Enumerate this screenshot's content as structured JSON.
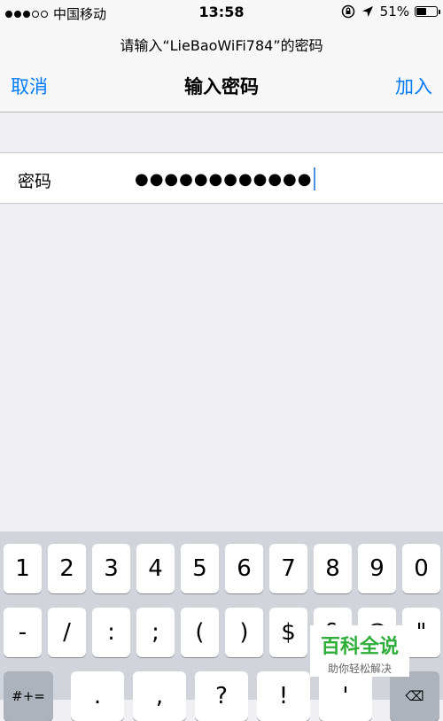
{
  "status": {
    "carrier": "中国移动",
    "time": "13:58",
    "battery": "51%",
    "battery_level": 0.51
  },
  "nav": {
    "prompt": "请输入“LieBaoWiFi784”的密码",
    "title": "输入密码",
    "cancel": "取消",
    "join": "加入"
  },
  "form": {
    "password_label": "密码",
    "password_value": "●●●●●●●●●●●●"
  },
  "keyboard": {
    "row1": [
      "1",
      "2",
      "3",
      "4",
      "5",
      "6",
      "7",
      "8",
      "9",
      "0"
    ],
    "row2": [
      "-",
      "/",
      ":",
      ";",
      "(",
      ")",
      "$",
      "&",
      "@",
      "\""
    ],
    "row3": [
      "#+=",
      ".",
      ",",
      "?",
      "!",
      "'",
      "⌫"
    ]
  },
  "watermark": {
    "title": "百科全说",
    "subtitle": "助你轻松解决"
  },
  "icons": {
    "lock": "rotation-lock-icon",
    "location": "location-arrow-icon",
    "battery": "battery-icon",
    "delete": "backspace-icon"
  }
}
